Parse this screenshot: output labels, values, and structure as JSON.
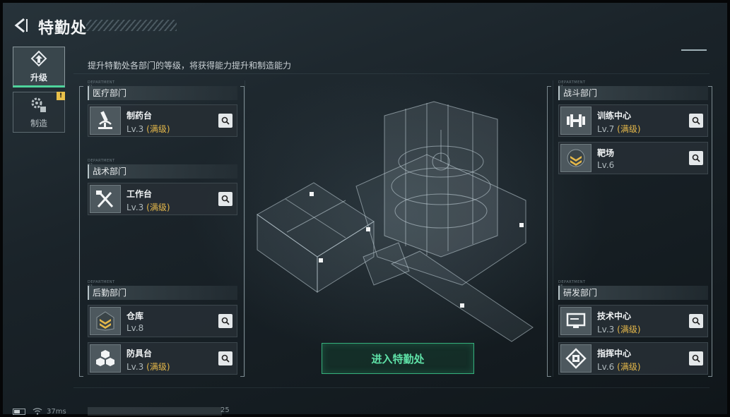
{
  "header": {
    "title": "特勤处"
  },
  "subtitle": "提升特勤处各部门的等级，将获得能力提升和制造能力",
  "side_tabs": [
    {
      "label": "升级",
      "icon": "upgrade-icon",
      "active": true
    },
    {
      "label": "制造",
      "icon": "gears-icon",
      "active": false,
      "badge": "!"
    }
  ],
  "departments": {
    "medical": {
      "tag": "DEPARTMENT 01",
      "title": "医疗部门",
      "items": [
        {
          "name": "制药台",
          "level": "Lv.3",
          "max": "(满级)",
          "icon": "microscope-icon"
        }
      ]
    },
    "tactical": {
      "tag": "DEPARTMENT 02",
      "title": "战术部门",
      "items": [
        {
          "name": "工作台",
          "level": "Lv.3",
          "max": "(满级)",
          "icon": "tools-icon"
        }
      ]
    },
    "logistics": {
      "tag": "DEPARTMENT 03",
      "title": "后勤部门",
      "items": [
        {
          "name": "仓库",
          "level": "Lv.8",
          "max": "",
          "icon": "chevrons-icon"
        },
        {
          "name": "防具台",
          "level": "Lv.3",
          "max": "(满级)",
          "icon": "cubes-icon"
        }
      ]
    },
    "combat": {
      "tag": "DEPARTMENT 04",
      "title": "战斗部门",
      "items": [
        {
          "name": "训练中心",
          "level": "Lv.7",
          "max": "(满级)",
          "icon": "dumbbell-icon"
        },
        {
          "name": "靶场",
          "level": "Lv.6",
          "max": "",
          "icon": "rank-chevron-icon"
        }
      ]
    },
    "research": {
      "tag": "DEPARTMENT 05",
      "title": "研发部门",
      "items": [
        {
          "name": "技术中心",
          "level": "Lv.3",
          "max": "(满级)",
          "icon": "monitor-icon"
        },
        {
          "name": "指挥中心",
          "level": "Lv.6",
          "max": "(满级)",
          "icon": "chip-icon"
        }
      ]
    }
  },
  "enter_button": "进入特勤处",
  "status": {
    "ping": "37ms",
    "uid_suffix": "25"
  },
  "colors": {
    "accent_green": "#5ee0a6",
    "max_level": "#e5b84a",
    "warn_badge": "#e8c04a"
  }
}
